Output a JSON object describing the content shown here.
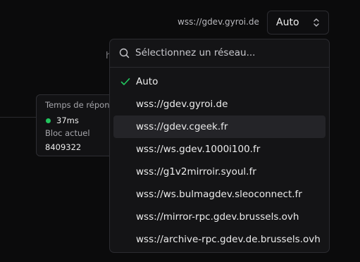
{
  "endpoint": {
    "label": "wss://gdev.gyroi.de",
    "select_value": "Auto"
  },
  "background": {
    "partial_text": "h"
  },
  "tooltip": {
    "response_label": "Temps de réponse",
    "response_value": "37ms",
    "status_color": "#22c55e",
    "block_label": "Bloc actuel",
    "block_value": "8409322"
  },
  "dropdown": {
    "search_placeholder": "Sélectionnez un réseau...",
    "options": [
      {
        "label": "Auto",
        "selected": true
      },
      {
        "label": "wss://gdev.gyroi.de",
        "selected": false
      },
      {
        "label": "wss://gdev.cgeek.fr",
        "selected": false,
        "highlighted": true
      },
      {
        "label": "wss://ws.gdev.1000i100.fr",
        "selected": false
      },
      {
        "label": "wss://g1v2mirroir.syoul.fr",
        "selected": false
      },
      {
        "label": "wss://ws.bulmagdev.sleoconnect.fr",
        "selected": false
      },
      {
        "label": "wss://mirror-rpc.gdev.brussels.ovh",
        "selected": false
      },
      {
        "label": "wss://archive-rpc.gdev.de.brussels.ovh",
        "selected": false
      }
    ]
  },
  "colors": {
    "check": "#22c55e",
    "highlight": "#242428"
  },
  "icons": {
    "select": "chevron-up-down-icon",
    "search": "search-icon",
    "selected": "check-icon"
  }
}
